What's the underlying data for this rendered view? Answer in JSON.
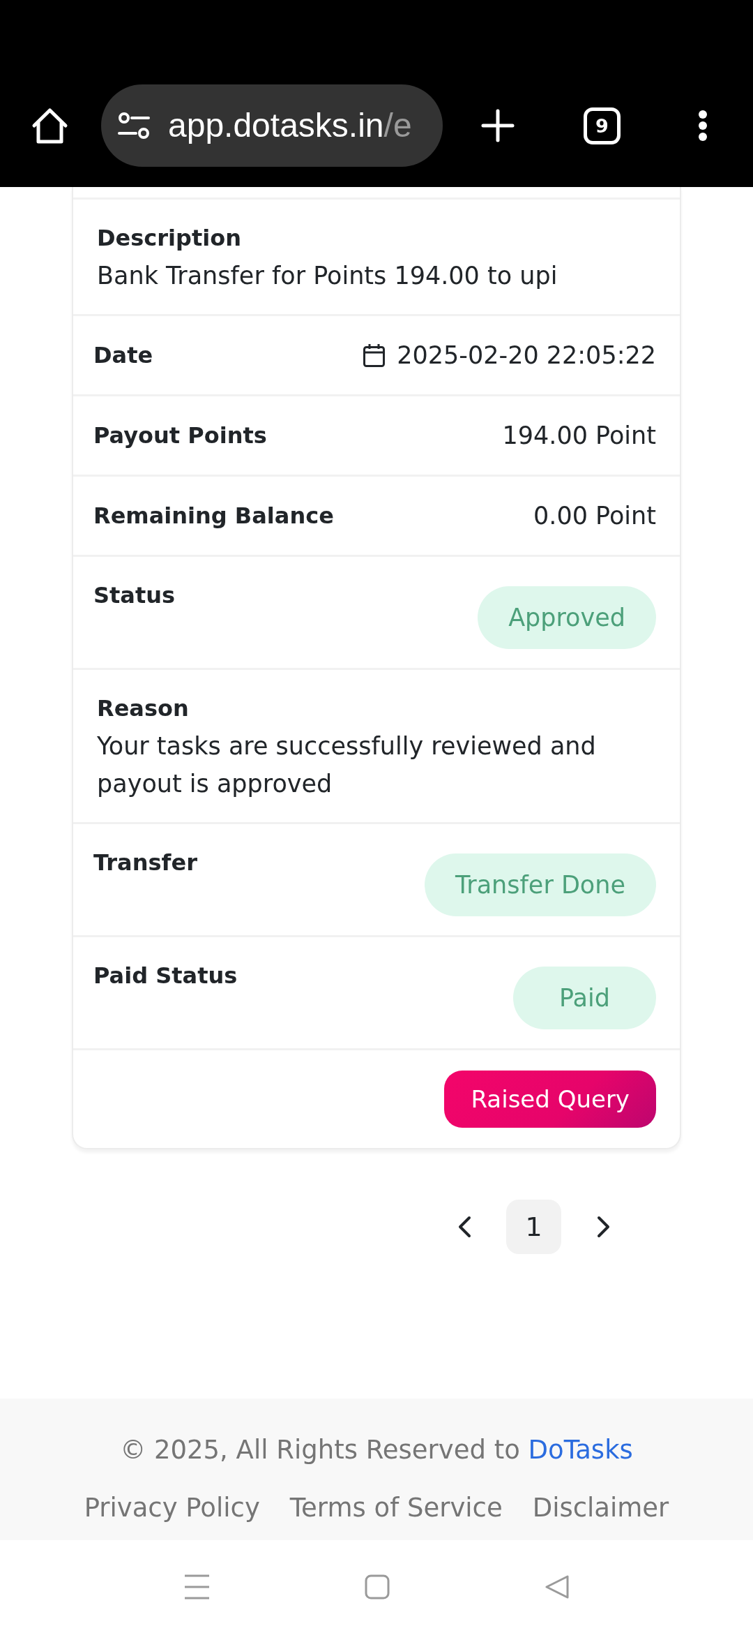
{
  "browser": {
    "url": {
      "host": "app.dotasks.in",
      "path": "/e"
    },
    "tab_count": "9"
  },
  "transaction": {
    "rows": [
      {
        "kind": "stacked",
        "label": "Description",
        "value": "Bank Transfer for Points 194.00 to upi"
      },
      {
        "kind": "date",
        "label": "Date",
        "value": "2025-02-20 22:05:22"
      },
      {
        "kind": "text",
        "label": "Payout Points",
        "value": "194.00 Point"
      },
      {
        "kind": "text",
        "label": "Remaining Balance",
        "value": "0.00 Point"
      },
      {
        "kind": "badge",
        "label": "Status",
        "value": "Approved"
      },
      {
        "kind": "stacked",
        "label": "Reason",
        "value": "Your tasks are successfully reviewed and payout is approved"
      },
      {
        "kind": "badge",
        "label": "Transfer",
        "value": "Transfer Done"
      },
      {
        "kind": "badge",
        "label": "Paid Status",
        "value": "Paid"
      }
    ],
    "action_button": "Raised Query"
  },
  "pagination": {
    "pages": [
      {
        "label": "1",
        "selected": true
      }
    ]
  },
  "footer": {
    "copyright": "© 2025, All Rights Reserved to",
    "brand_link": "DoTasks",
    "links": [
      "Privacy Policy",
      "Terms of Service",
      "Disclaimer"
    ]
  }
}
